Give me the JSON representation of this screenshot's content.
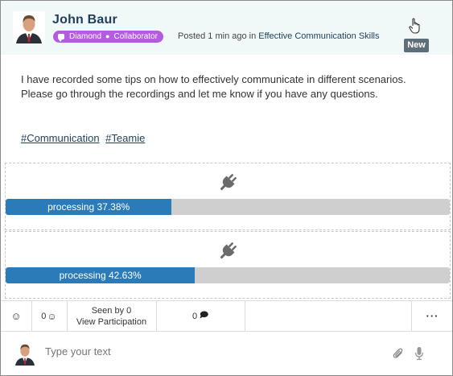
{
  "post": {
    "author": "John Baur",
    "badge_level": "Diamond",
    "badge_role": "Collaborator",
    "posted_prefix": "Posted 1 min ago in",
    "course": "Effective Communication Skills",
    "new_label": "New",
    "body_line1": "I have recorded some tips on how to effectively communicate in different scenarios.",
    "body_line2": "Please go through the recordings and let me know if you have any questions.",
    "hashtags": [
      "#Communication",
      "#Teamie"
    ]
  },
  "attachments": [
    {
      "icon": "plug-icon",
      "label": "processing 37.38%",
      "progress": 37.38
    },
    {
      "icon": "plug-icon",
      "label": "processing 42.63%",
      "progress": 42.63
    }
  ],
  "actions": {
    "reaction_count": "0",
    "seen_by": "Seen by 0",
    "view_participation": "View Participation",
    "comment_count": "0",
    "more": "···"
  },
  "composer": {
    "placeholder": "Type your text"
  },
  "colors": {
    "header_bg": "#f1f8f8",
    "badge": "#b45ce0",
    "progress_fill": "#2b7bb9",
    "progress_track": "#cfcfcf",
    "new_tag": "#5f6f79",
    "link": "#1f3e5c"
  }
}
